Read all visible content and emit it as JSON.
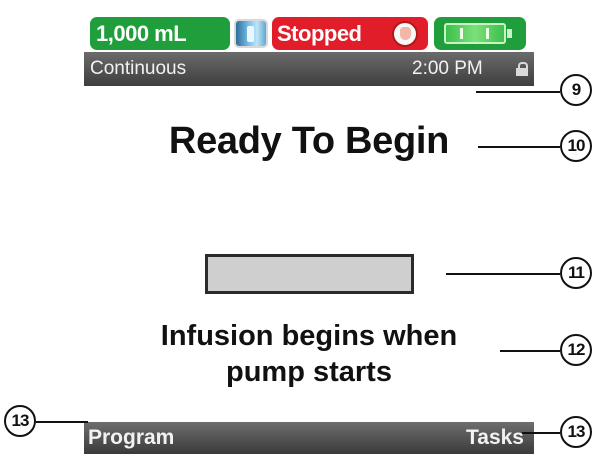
{
  "status": {
    "volume": "1,000 mL",
    "state": "Stopped",
    "icons": [
      "iv-bag-icon",
      "stop-hand-icon",
      "battery-icon",
      "lock-icon"
    ]
  },
  "mode_bar": {
    "mode": "Continuous",
    "time": "2:00 PM"
  },
  "main": {
    "title": "Ready To Begin",
    "progress_fraction": 0,
    "message_line1": "Infusion begins when",
    "message_line2": "pump starts"
  },
  "softkeys": {
    "left": "Program",
    "right": "Tasks"
  },
  "callouts": [
    "9",
    "10",
    "11",
    "12",
    "13",
    "13"
  ],
  "colors": {
    "volume_green": "#1f9e3b",
    "stopped_red": "#e21d2a",
    "bar_gray": "#4a4a4a",
    "progress_gray": "#cfcfcf"
  }
}
